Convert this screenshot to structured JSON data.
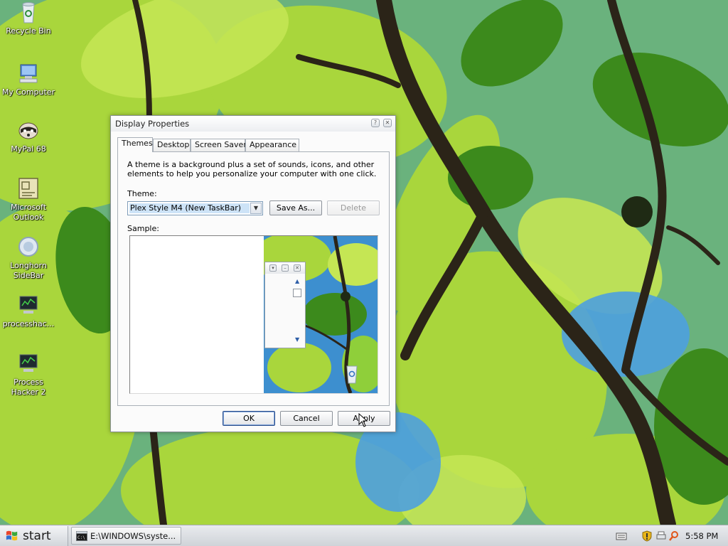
{
  "desktop": {
    "icons": [
      {
        "label": "Recycle Bin",
        "icon": "recycle-bin-icon"
      },
      {
        "label": "My Computer",
        "icon": "computer-icon"
      },
      {
        "label": "MyPal 68",
        "icon": "raccoon-browser-icon"
      },
      {
        "label": "Microsoft Outlook",
        "icon": "outlook-icon"
      },
      {
        "label": "Longhorn SideBar",
        "icon": "sidebar-icon"
      },
      {
        "label": "processhac...",
        "icon": "process-hacker-icon"
      },
      {
        "label": "Process Hacker 2",
        "icon": "process-hacker-icon"
      }
    ]
  },
  "dialog": {
    "title": "Display Properties",
    "tabs": [
      "Themes",
      "Desktop",
      "Screen Saver",
      "Appearance"
    ],
    "active_tab": "Themes",
    "description": "A theme is a background plus a set of sounds, icons, and other elements to help you personalize your computer with one click.",
    "theme_label": "Theme:",
    "theme_value": "Plex Style M4 (New TaskBar)",
    "save_as": "Save As...",
    "delete": "Delete",
    "sample_label": "Sample:",
    "buttons": {
      "ok": "OK",
      "cancel": "Cancel",
      "apply": "Apply"
    }
  },
  "taskbar": {
    "start": "start",
    "task_item": "E:\\WINDOWS\\syste...",
    "clock": "5:58 PM"
  },
  "colors": {
    "wallpaper_sky": "#3a8ed0",
    "leaf_green": "#a6d23a",
    "selection": "#cde3f7"
  }
}
